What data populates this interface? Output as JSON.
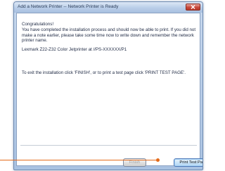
{
  "window": {
    "title": "Add a Network Printer -- Network Printer is Ready"
  },
  "content": {
    "congrats": "Congratulations!",
    "message": "You have completed the installation process and should now be able to print. If you did not make a note earlier, please take some time now to write down and remember the network printer name.",
    "printer_name": "Lexmark Z22-Z32 Color Jetprinter at //PS-XXXXXX/P1",
    "exit_instructions": "To exit the installation click 'FINISH', or to print a test page click 'PRINT TEST PAGE'."
  },
  "buttons": {
    "finish_label": "Finish",
    "print_test_label": "Print Test Page"
  },
  "colors": {
    "callout": "#e46a1a",
    "title_bar": "#b9cde8",
    "close_button": "#c7483a"
  },
  "icons": {
    "close": "close-icon"
  }
}
